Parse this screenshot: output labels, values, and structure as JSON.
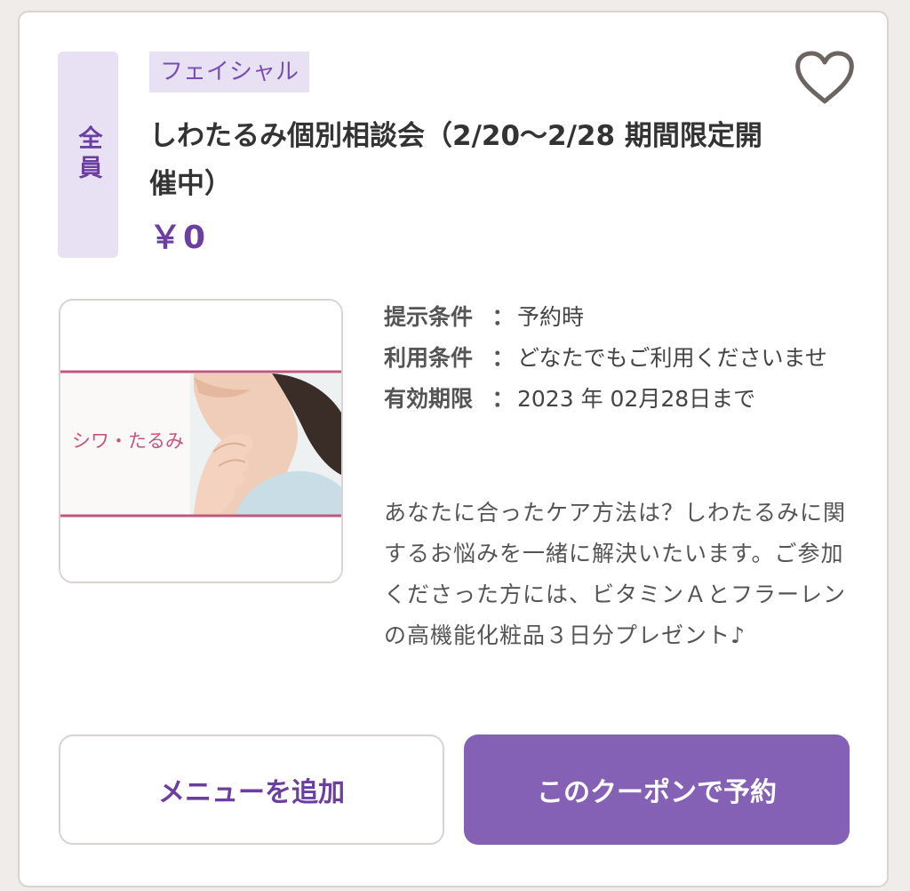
{
  "coupon": {
    "target_badge": "全員",
    "category": "フェイシャル",
    "title": "しわたるみ個別相談会（2/20〜2/28 期間限定開催中）",
    "price": "￥0",
    "favorite_icon": "heart-outline-icon",
    "image": {
      "caption": "シワ・たるみ"
    },
    "terms": [
      {
        "label": "提示条件",
        "sep": "：",
        "value": "予約時"
      },
      {
        "label": "利用条件",
        "sep": "：",
        "value": "どなたでもご利用くださいませ"
      },
      {
        "label": "有効期限",
        "sep": "：",
        "value": "2023 年 02月28日まで"
      }
    ],
    "description": "あなたに合ったケア方法は？しわたるみに関するお悩みを一緒に解決いたいます。ご参加くださった方には、ビタミンＡとフラーレンの高機能化粧品３日分プレゼント♪"
  },
  "actions": {
    "add_menu_label": "メニューを追加",
    "reserve_label": "このクーポンで予約"
  },
  "colors": {
    "accent": "#6b3fa0",
    "accent_button": "#8561b5",
    "tag_background": "#e8e0f3",
    "border": "#d9d4d2",
    "image_line": "#c0577f"
  }
}
